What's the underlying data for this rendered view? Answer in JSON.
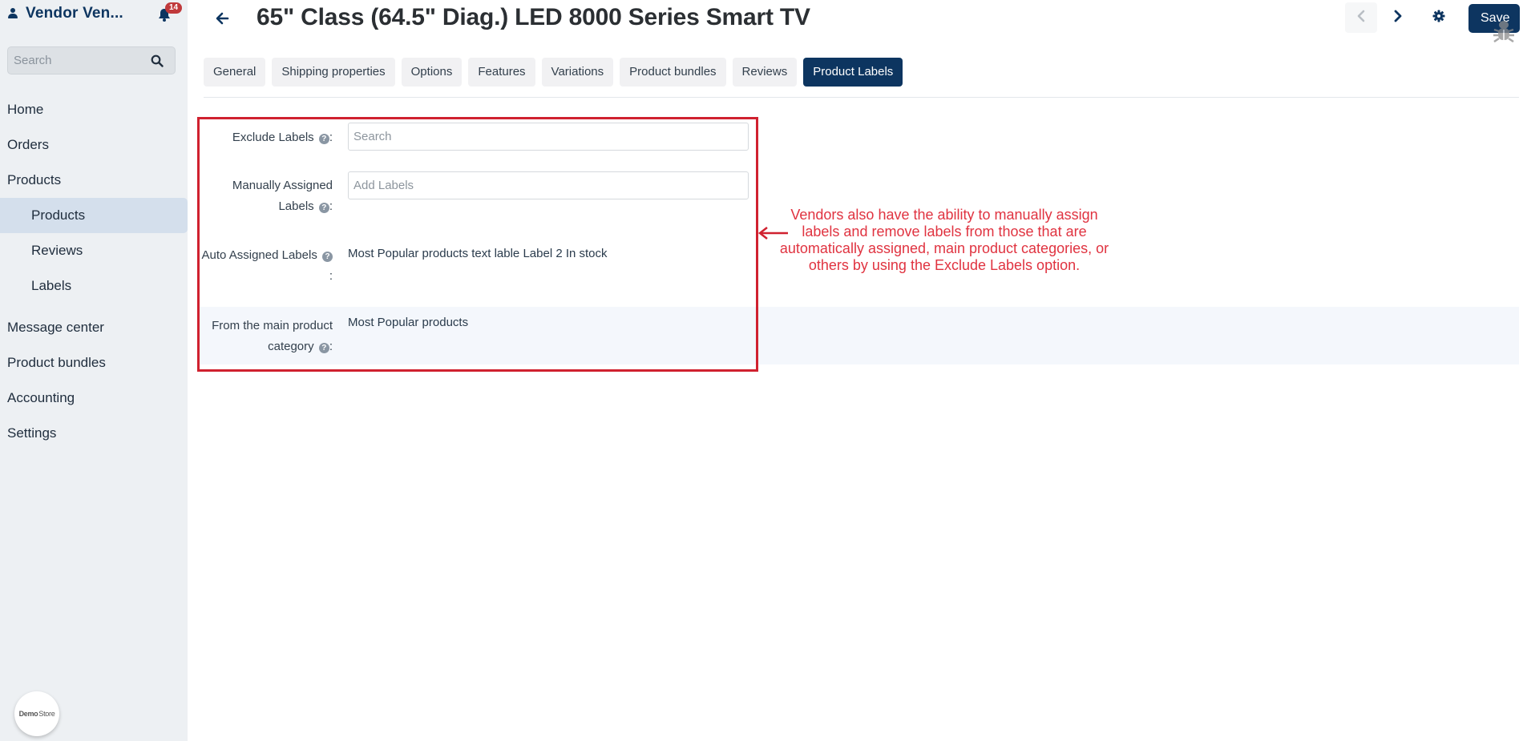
{
  "sidebar": {
    "vendor_name": "Vendor Ven...",
    "notifications_count": "14",
    "search_placeholder": "Search",
    "nav": [
      {
        "label": "Home",
        "level": 0,
        "active": false
      },
      {
        "label": "Orders",
        "level": 0,
        "active": false
      },
      {
        "label": "Products",
        "level": 0,
        "active": false
      },
      {
        "label": "Products",
        "level": 1,
        "active": true
      },
      {
        "label": "Reviews",
        "level": 1,
        "active": false
      },
      {
        "label": "Labels",
        "level": 1,
        "active": false
      },
      {
        "label": "Message center",
        "level": 0,
        "active": false
      },
      {
        "label": "Product bundles",
        "level": 0,
        "active": false
      },
      {
        "label": "Accounting",
        "level": 0,
        "active": false
      },
      {
        "label": "Settings",
        "level": 0,
        "active": false
      }
    ],
    "logo": {
      "bold": "Demo",
      "light": "Store"
    }
  },
  "header": {
    "title": "65\" Class (64.5\" Diag.) LED 8000 Series Smart TV",
    "save_label": "Save",
    "icons": [
      "back-arrow-icon",
      "chevron-left-icon",
      "chevron-right-icon",
      "gear-icon",
      "bug-icon"
    ]
  },
  "tabs": [
    {
      "label": "General",
      "active": false
    },
    {
      "label": "Shipping properties",
      "active": false
    },
    {
      "label": "Options",
      "active": false
    },
    {
      "label": "Features",
      "active": false
    },
    {
      "label": "Variations",
      "active": false
    },
    {
      "label": "Product bundles",
      "active": false
    },
    {
      "label": "Reviews",
      "active": false
    },
    {
      "label": "Product Labels",
      "active": true
    }
  ],
  "form": {
    "exclude_labels": {
      "label": "Exclude Labels",
      "placeholder": "Search",
      "value": ""
    },
    "manual_labels": {
      "label_line1": "Manually Assigned",
      "label_line2": "Labels",
      "placeholder": "Add Labels",
      "value": ""
    },
    "auto_labels": {
      "label_line1": "Auto Assigned Labels",
      "label_line2": ":",
      "value": "Most Popular products text lable Label 2 In stock"
    },
    "main_category": {
      "label_line1": "From the main product",
      "label_line2": "category",
      "value": "Most Popular products"
    },
    "help_glyph": "?",
    "colon": ":"
  },
  "annotation": {
    "text": "Vendors also have the ability to manually assign labels and remove labels from those that are automatically assigned, main product categories, or others by using the Exclude Labels option.",
    "color": "#e03340",
    "box_color": "#d0212f"
  },
  "colors": {
    "brand": "#0d3560",
    "sidebar_bg": "#edf0f3",
    "active_nav_bg": "#d4dfec",
    "badge": "#c0393b"
  }
}
